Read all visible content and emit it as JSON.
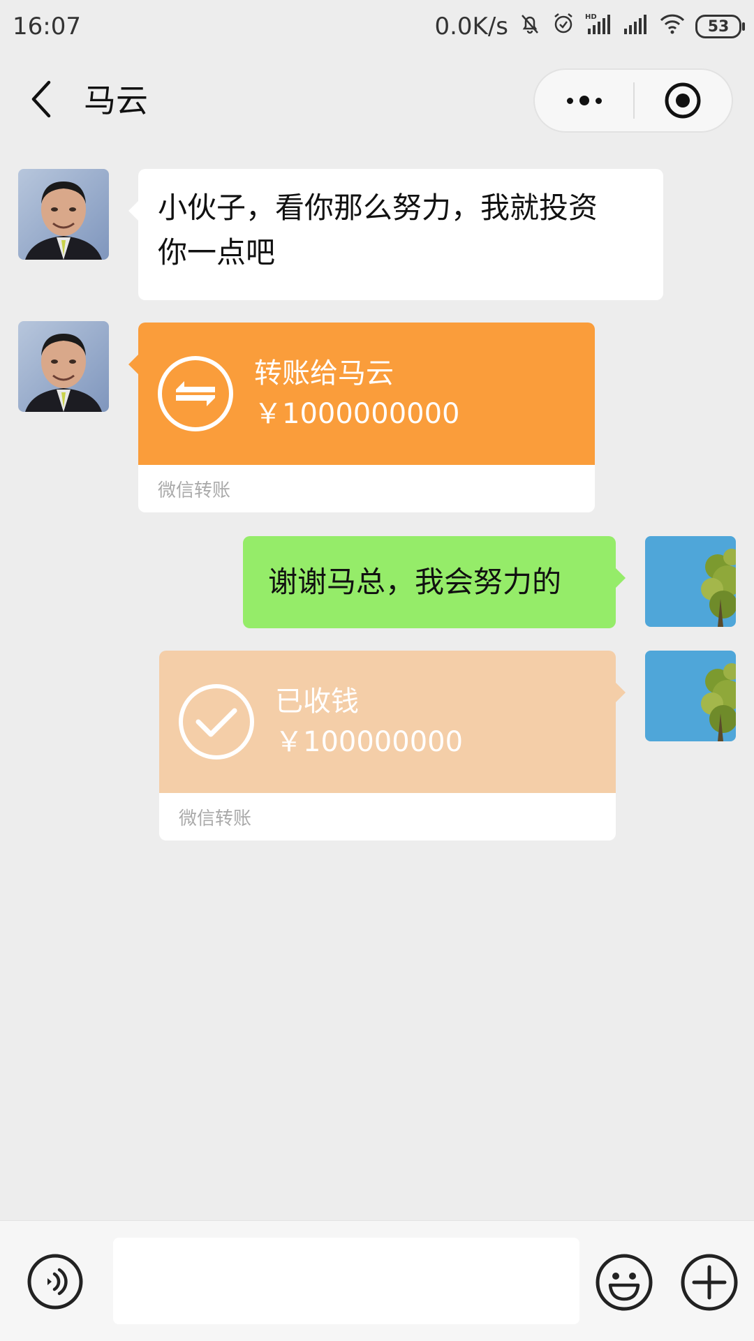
{
  "status_bar": {
    "time": "16:07",
    "network_speed": "0.0K/s",
    "icons": [
      "mute-bell-icon",
      "alarm-icon",
      "hd-signal-icon",
      "signal-icon",
      "wifi-icon"
    ],
    "battery": "53"
  },
  "nav": {
    "title": "马云",
    "back_icon": "chevron-left-icon",
    "more_icon": "more-dots-icon",
    "close_icon": "target-circle-icon"
  },
  "messages": [
    {
      "side": "left",
      "type": "text",
      "text_line1": "小伙子，看你那么努力，我就投资",
      "text_line2": "你一点吧"
    },
    {
      "side": "left",
      "type": "transfer",
      "title": "转账给马云",
      "amount": "￥1000000000",
      "footer": "微信转账",
      "color": "#fa9d3b"
    },
    {
      "side": "right",
      "type": "text",
      "text": "谢谢马总，我会努力的",
      "color": "#95ec69"
    },
    {
      "side": "right",
      "type": "transfer",
      "title": "已收钱",
      "amount": "￥100000000",
      "footer": "微信转账",
      "color": "#f4cea8"
    }
  ],
  "input_bar": {
    "placeholder": "",
    "voice_icon": "voice-icon",
    "emoji_icon": "emoji-icon",
    "plus_icon": "plus-icon"
  }
}
